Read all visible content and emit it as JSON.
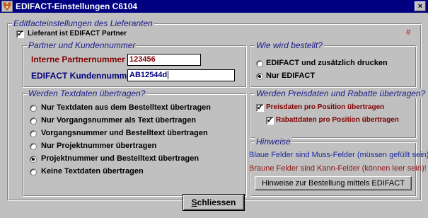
{
  "window": {
    "title": "EDIFACT-Einstellungen C6104",
    "close_glyph": "×"
  },
  "main_group": {
    "title": "Editfacteinstellungen des Lieferanten",
    "partner_checkbox": {
      "label": "Lieferant ist EDIFACT Partner",
      "checked": true
    },
    "hash_mark": "#"
  },
  "partner_group": {
    "title": "Partner und Kundennummer",
    "internal_label": "Interne Partnernummer",
    "internal_value": "123456",
    "edifact_label": "EDIFACT Kundennummer",
    "edifact_value": "AB12544d"
  },
  "order_group": {
    "title": "Wie wird bestellt?",
    "options": [
      {
        "label": "EDIFACT und zusätzlich drucken",
        "selected": false
      },
      {
        "label": "Nur EDIFACT",
        "selected": true
      }
    ]
  },
  "text_group": {
    "title": "Werden Textdaten übertragen?",
    "options": [
      {
        "label": "Nur Textdaten aus dem Bestelltext übertragen",
        "selected": false
      },
      {
        "label": "Nur Vorgangsnummer als Text übertragen",
        "selected": false
      },
      {
        "label": "Vorgangsnummer und Bestelltext übertragen",
        "selected": false
      },
      {
        "label": "Nur Projektnummer übertragen",
        "selected": false
      },
      {
        "label": "Projektnummer und Bestelltext übertragen",
        "selected": true
      },
      {
        "label": "Keine Textdaten übertragen",
        "selected": false
      }
    ]
  },
  "price_group": {
    "title": "Werden Preisdaten und Rabatte übertragen?",
    "price_checkbox": {
      "label": "Preisdaten pro Position übertragen",
      "checked": true
    },
    "discount_checkbox": {
      "label": "Rabattdaten pro Position übertragen",
      "checked": true
    }
  },
  "hints_group": {
    "title": "Hinweise",
    "blue_hint": "Blaue Felder sind Muss-Felder (müssen gefüllt sein)!",
    "red_hint": "Braune Felder sind Kann-Felder (können leer sein)!",
    "button_label": "Hinweise zur Bestellung mittels EDIFACT"
  },
  "footer": {
    "close_button_label": "Schliessen",
    "close_button_mnemonic": "S",
    "close_button_rest": "chliessen"
  },
  "colors": {
    "title_bar": "#000080",
    "group_title": "#1a1a8a",
    "mandatory_blue": "#00007b",
    "optional_red": "#800000"
  }
}
